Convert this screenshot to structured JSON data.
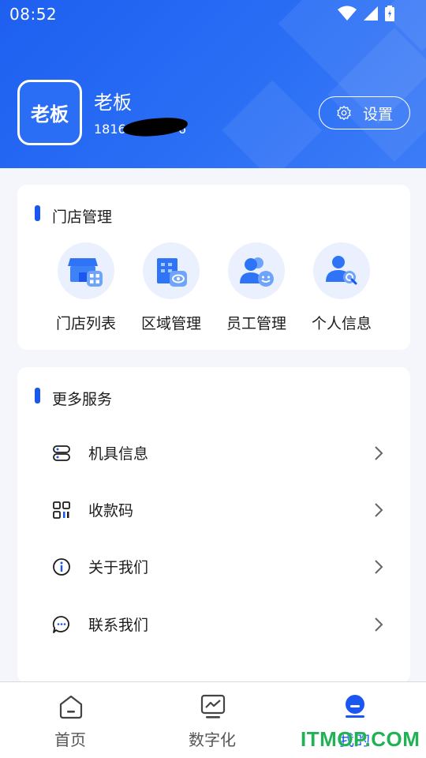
{
  "status_bar": {
    "time": "08:52"
  },
  "profile": {
    "avatar_text": "老板",
    "name": "老板",
    "phone": "18166",
    "phone_end": "6",
    "settings_label": "设置"
  },
  "store_section": {
    "title": "门店管理",
    "items": [
      {
        "label": "门店列表",
        "icon": "store-list-icon"
      },
      {
        "label": "区域管理",
        "icon": "area-management-icon"
      },
      {
        "label": "员工管理",
        "icon": "staff-management-icon"
      },
      {
        "label": "个人信息",
        "icon": "personal-info-icon"
      }
    ]
  },
  "services_section": {
    "title": "更多服务",
    "items": [
      {
        "label": "机具信息",
        "icon": "device-info-icon"
      },
      {
        "label": "收款码",
        "icon": "qr-code-icon"
      },
      {
        "label": "关于我们",
        "icon": "info-icon"
      },
      {
        "label": "联系我们",
        "icon": "chat-icon"
      }
    ]
  },
  "tab_bar": {
    "tabs": [
      {
        "label": "首页",
        "icon": "home-icon"
      },
      {
        "label": "数字化",
        "icon": "monitor-chart-icon"
      },
      {
        "label": "我的",
        "icon": "profile-icon",
        "active": true
      }
    ]
  },
  "watermark": "ITMOP.COM",
  "colors": {
    "primary": "#1a56f0",
    "header": "#2a6ef5",
    "background": "#f4f6fb",
    "watermark": "#20b254"
  }
}
